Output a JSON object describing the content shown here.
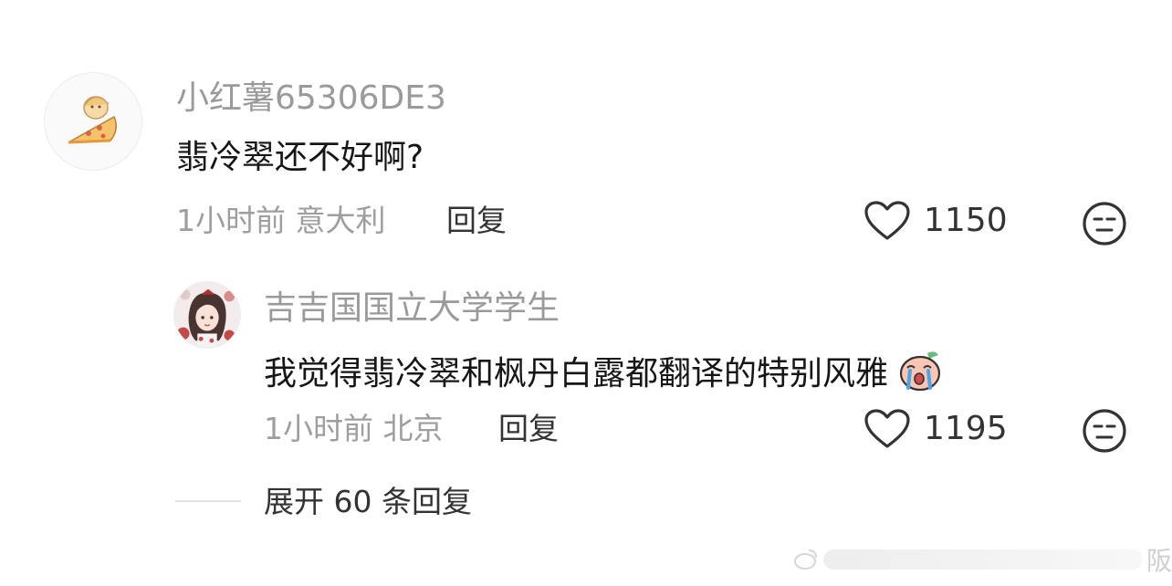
{
  "comments": [
    {
      "username": "小红薯65306DE3",
      "text": "翡冷翠还不好啊?",
      "time": "1小时前",
      "location": "意大利",
      "reply_label": "回复",
      "likes": "1150",
      "avatar_icon": "pizza-character-icon"
    },
    {
      "username": "吉吉国国立大学学生",
      "text": "我觉得翡冷翠和枫丹白露都翻译的特别风雅",
      "emoji_icon": "crying-peach-emoji-icon",
      "time": "1小时前",
      "location": "北京",
      "reply_label": "回复",
      "likes": "1195",
      "avatar_icon": "anime-girl-avatar-icon"
    }
  ],
  "expand_label": "展开 60 条回复",
  "watermark_text": "阪",
  "colors": {
    "muted": "#9e9e9e",
    "text": "#161616",
    "accent_gray": "#333333"
  }
}
